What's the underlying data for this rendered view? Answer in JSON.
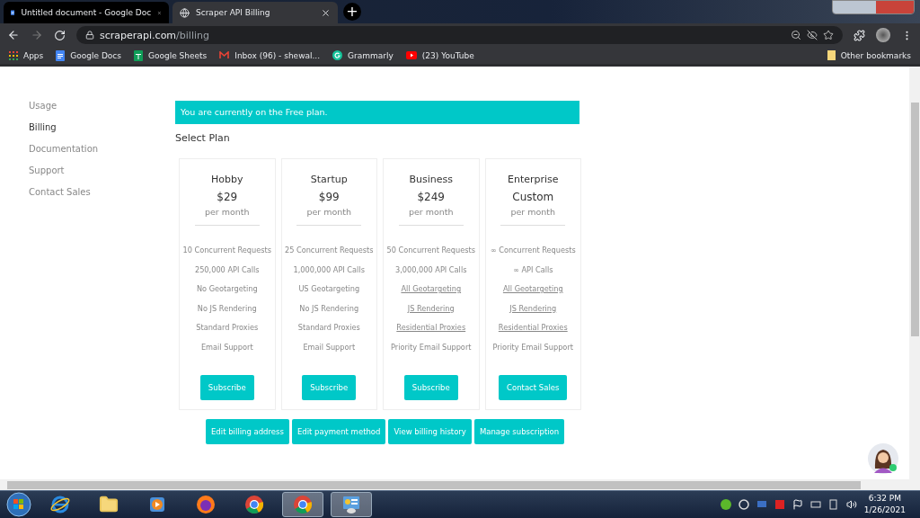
{
  "browser": {
    "tabs": [
      {
        "title": "Untitled document - Google Doc",
        "kind": "docs",
        "selected": false
      },
      {
        "title": "Scraper API Billing",
        "kind": "globe",
        "selected": true
      }
    ],
    "new_tab": "+",
    "address": {
      "host": "scraperapi.com",
      "path": "/billing"
    },
    "bookmarks": [
      {
        "label": "Apps",
        "kind": "apps"
      },
      {
        "label": "Google Docs",
        "kind": "docs"
      },
      {
        "label": "Google Sheets",
        "kind": "sheets"
      },
      {
        "label": "Inbox (96) - shewal...",
        "kind": "mail"
      },
      {
        "label": "Grammarly",
        "kind": "grammarly"
      },
      {
        "label": "(23) YouTube",
        "kind": "youtube"
      }
    ],
    "other_bookmarks": "Other bookmarks"
  },
  "sidebar": {
    "items": [
      {
        "label": "Usage",
        "selected": false
      },
      {
        "label": "Billing",
        "selected": true
      },
      {
        "label": "Documentation",
        "selected": false
      },
      {
        "label": "Support",
        "selected": false
      },
      {
        "label": "Contact Sales",
        "selected": false
      }
    ]
  },
  "banner": "You are currently on the Free plan.",
  "section_title": "Select Plan",
  "plans": [
    {
      "name": "Hobby",
      "price": "$29",
      "period": "per month",
      "features": [
        {
          "text": "10 Concurrent Requests",
          "kind": "text"
        },
        {
          "text": "250,000 API Calls",
          "kind": "text"
        },
        {
          "text": "No Geotargeting",
          "kind": "text"
        },
        {
          "text": "No JS Rendering",
          "kind": "text"
        },
        {
          "text": "Standard Proxies",
          "kind": "text"
        },
        {
          "text": "Email Support",
          "kind": "text"
        }
      ],
      "button": "Subscribe"
    },
    {
      "name": "Startup",
      "price": "$99",
      "period": "per month",
      "features": [
        {
          "text": "25 Concurrent Requests",
          "kind": "text"
        },
        {
          "text": "1,000,000 API Calls",
          "kind": "text"
        },
        {
          "text": "US Geotargeting",
          "kind": "text"
        },
        {
          "text": "No JS Rendering",
          "kind": "text"
        },
        {
          "text": "Standard Proxies",
          "kind": "text"
        },
        {
          "text": "Email Support",
          "kind": "text"
        }
      ],
      "button": "Subscribe"
    },
    {
      "name": "Business",
      "price": "$249",
      "period": "per month",
      "features": [
        {
          "text": "50 Concurrent Requests",
          "kind": "text"
        },
        {
          "text": "3,000,000 API Calls",
          "kind": "text"
        },
        {
          "text": "All Geotargeting",
          "kind": "link"
        },
        {
          "text": "JS Rendering",
          "kind": "link"
        },
        {
          "text": "Residential Proxies",
          "kind": "link"
        },
        {
          "text": "Priority Email Support",
          "kind": "text"
        }
      ],
      "button": "Subscribe"
    },
    {
      "name": "Enterprise",
      "price": "Custom",
      "period": "per month",
      "features": [
        {
          "text": "∞ Concurrent Requests",
          "kind": "text"
        },
        {
          "text": "∞ API Calls",
          "kind": "text"
        },
        {
          "text": "All Geotargeting",
          "kind": "link"
        },
        {
          "text": "JS Rendering",
          "kind": "link"
        },
        {
          "text": "Residential Proxies",
          "kind": "link"
        },
        {
          "text": "Priority Email Support",
          "kind": "text"
        }
      ],
      "button": "Contact Sales"
    }
  ],
  "actions": [
    "Edit billing address",
    "Edit payment method",
    "View billing history",
    "Manage subscription"
  ],
  "chat": {
    "online": true
  },
  "taskbar": {
    "apps": [
      {
        "kind": "ie",
        "selected": false
      },
      {
        "kind": "folder",
        "selected": false
      },
      {
        "kind": "media",
        "selected": false
      },
      {
        "kind": "firefox",
        "selected": false
      },
      {
        "kind": "chrome",
        "selected": false
      },
      {
        "kind": "chrome",
        "selected": true
      },
      {
        "kind": "panel",
        "selected": true
      }
    ],
    "time": "6:32 PM",
    "date": "1/26/2021"
  }
}
